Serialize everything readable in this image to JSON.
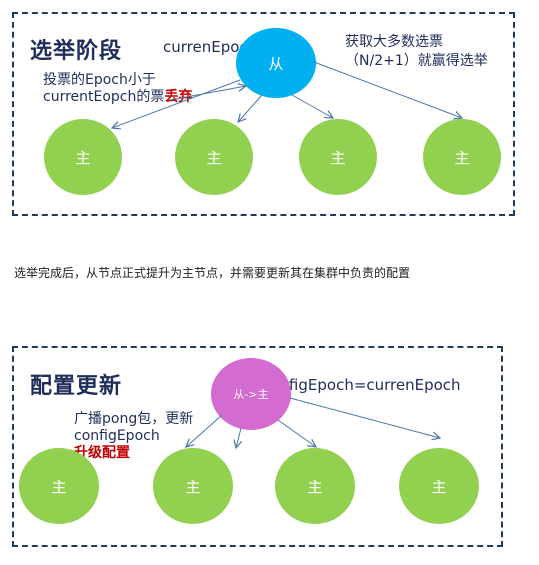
{
  "election": {
    "title": "选举阶段",
    "slave_node": "从",
    "epoch_label": "currenEpoch",
    "win_rule": "获取大多数选票（N/2+1）就赢得选举",
    "discard_rule_prefix": "投票的Epoch小于currentEopch的票",
    "discard_rule_highlight": "丢弃",
    "master_nodes": [
      "主",
      "主",
      "主",
      "主"
    ]
  },
  "summary": "选举完成后，从节点正式提升为主节点，并需要更新其在集群中负责的配置",
  "config_update": {
    "title": "配置更新",
    "promote_node": "从->主",
    "epoch_assign": "configEpoch=currenEpoch",
    "broadcast_prefix": "广播pong包，更新configEpoch",
    "broadcast_highlight": "升级配置",
    "master_nodes": [
      "主",
      "主",
      "主",
      "主"
    ]
  },
  "colors": {
    "master": "#92d050",
    "slave": "#00b0f0",
    "promote": "#d36bd0",
    "arrow": "#4a78a8",
    "border": "#1f3b5c",
    "highlight": "#c00000"
  }
}
